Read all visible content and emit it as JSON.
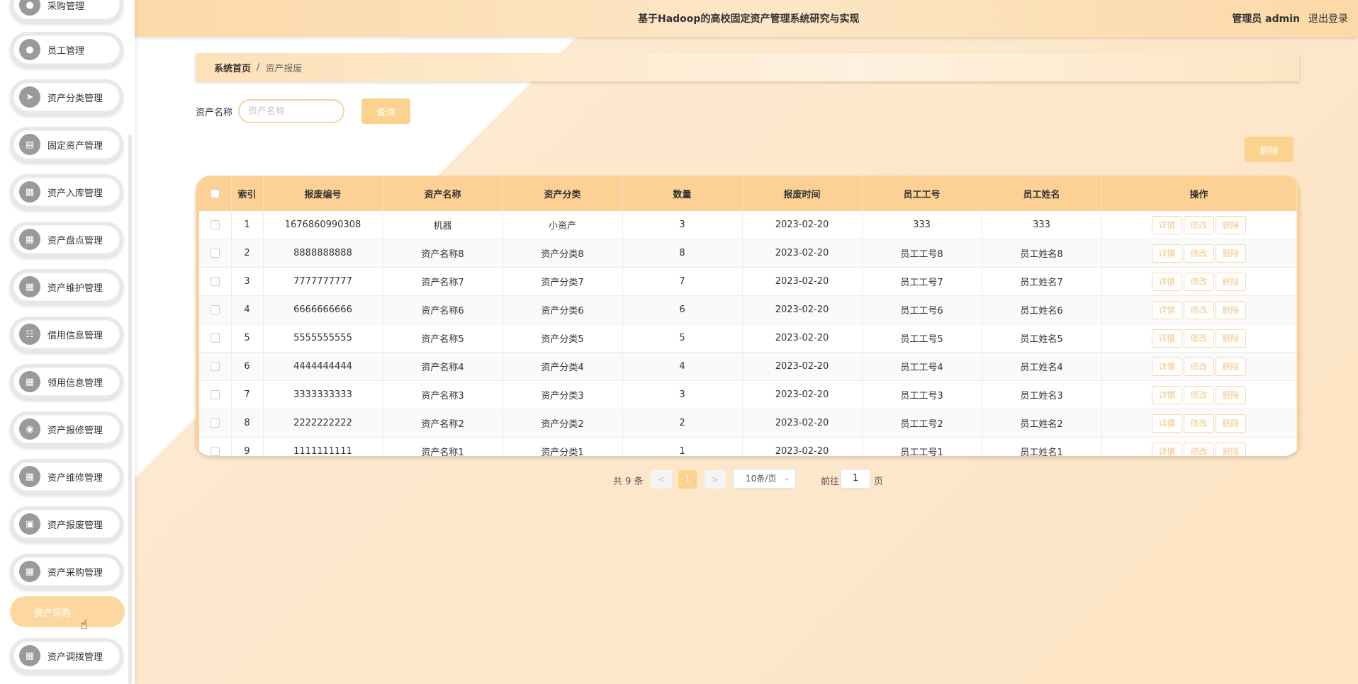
{
  "header": {
    "title": "基于Hadoop的高校固定资产管理系统研究与实现",
    "user": "管理员 admin",
    "logout": "退出登录"
  },
  "sidebar": {
    "items": [
      {
        "label": "采购管理",
        "icon": "user-icon"
      },
      {
        "label": "员工管理",
        "icon": "user-icon"
      },
      {
        "label": "资产分类管理",
        "icon": "send-icon"
      },
      {
        "label": "固定资产管理",
        "icon": "monitor-icon"
      },
      {
        "label": "资产入库管理",
        "icon": "clipboard-icon"
      },
      {
        "label": "资产盘点管理",
        "icon": "grid-icon"
      },
      {
        "label": "资产维护管理",
        "icon": "grid-icon"
      },
      {
        "label": "借用信息管理",
        "icon": "list-grid-icon"
      },
      {
        "label": "领用信息管理",
        "icon": "grid-icon"
      },
      {
        "label": "资产报修管理",
        "icon": "bulb-icon"
      },
      {
        "label": "资产维修管理",
        "icon": "grid-icon"
      },
      {
        "label": "资产报废管理",
        "icon": "book-icon"
      },
      {
        "label": "资产采购管理",
        "icon": "grid-icon"
      }
    ],
    "sub_item": "资产采购",
    "last_item": {
      "label": "资产调拨管理",
      "icon": "grid-icon"
    }
  },
  "breadcrumb": {
    "home": "系统首页",
    "separator": "/",
    "current": "资产报废"
  },
  "search": {
    "label": "资产名称",
    "placeholder": "资产名称",
    "button": "查询"
  },
  "toolbar": {
    "delete": "删除"
  },
  "table": {
    "columns": [
      "索引",
      "报废编号",
      "资产名称",
      "资产分类",
      "数量",
      "报废时间",
      "员工工号",
      "员工姓名",
      "操作"
    ],
    "rows": [
      [
        "1",
        "1676860990308",
        "机器",
        "小资产",
        "3",
        "2023-02-20",
        "333",
        "333"
      ],
      [
        "2",
        "8888888888",
        "资产名称8",
        "资产分类8",
        "8",
        "2023-02-20",
        "员工工号8",
        "员工姓名8"
      ],
      [
        "3",
        "7777777777",
        "资产名称7",
        "资产分类7",
        "7",
        "2023-02-20",
        "员工工号7",
        "员工姓名7"
      ],
      [
        "4",
        "6666666666",
        "资产名称6",
        "资产分类6",
        "6",
        "2023-02-20",
        "员工工号6",
        "员工姓名6"
      ],
      [
        "5",
        "5555555555",
        "资产名称5",
        "资产分类5",
        "5",
        "2023-02-20",
        "员工工号5",
        "员工姓名5"
      ],
      [
        "6",
        "4444444444",
        "资产名称4",
        "资产分类4",
        "4",
        "2023-02-20",
        "员工工号4",
        "员工姓名4"
      ],
      [
        "7",
        "3333333333",
        "资产名称3",
        "资产分类3",
        "3",
        "2023-02-20",
        "员工工号3",
        "员工姓名3"
      ],
      [
        "8",
        "2222222222",
        "资产名称2",
        "资产分类2",
        "2",
        "2023-02-20",
        "员工工号2",
        "员工姓名2"
      ],
      [
        "9",
        "1111111111",
        "资产名称1",
        "资产分类1",
        "1",
        "2023-02-20",
        "员工工号1",
        "员工姓名1"
      ]
    ],
    "actions": [
      "详情",
      "修改",
      "删除"
    ]
  },
  "pagination": {
    "total": "共 9 条",
    "prev": "<",
    "current": "1",
    "next": ">",
    "page_size": "10条/页",
    "goto": "前往",
    "goto_value": "1",
    "page_suffix": "页"
  },
  "colors": {
    "accent": "#fcd28f",
    "header": "#fdd195"
  }
}
